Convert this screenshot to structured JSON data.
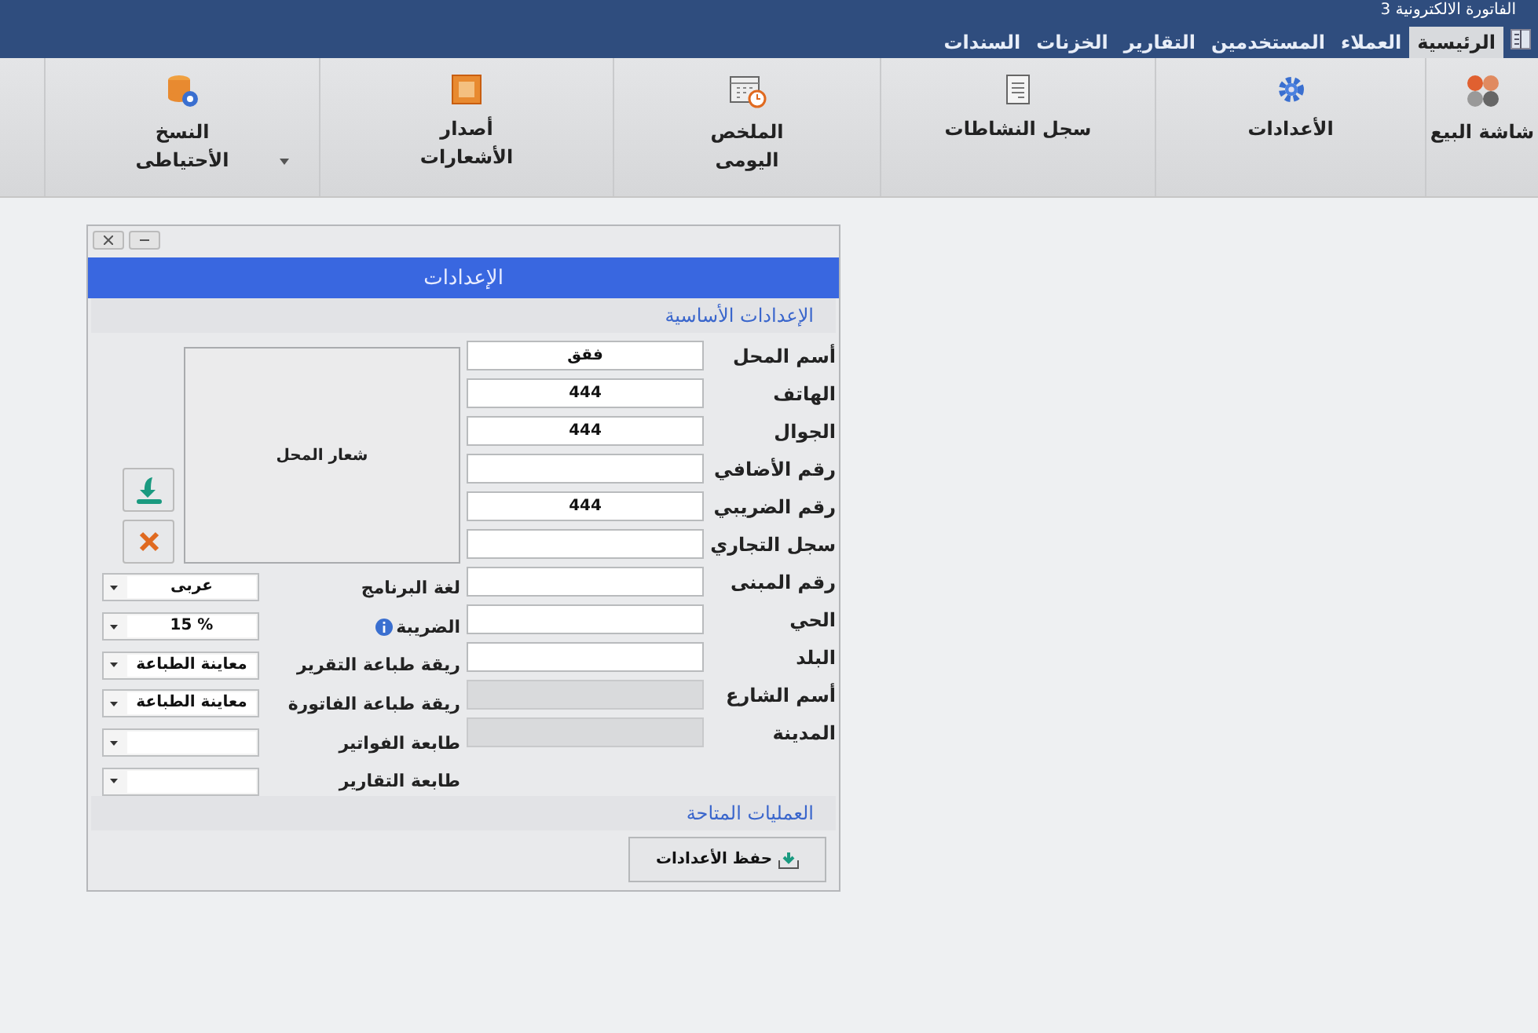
{
  "app_title": "الفاتورة الالكترونية 3",
  "menu_tabs": [
    {
      "label": "الرئيسية",
      "selected": true
    },
    {
      "label": "العملاء",
      "selected": false
    },
    {
      "label": "المستخدمين",
      "selected": false
    },
    {
      "label": "التقارير",
      "selected": false
    },
    {
      "label": "الخزنات",
      "selected": false
    },
    {
      "label": "السندات",
      "selected": false
    }
  ],
  "ribbon": [
    {
      "kind": "dots",
      "lines": [
        "شاشة البيع"
      ],
      "has_menu": false
    },
    {
      "kind": "gear",
      "lines": [
        "الأعدادات"
      ],
      "has_menu": false
    },
    {
      "kind": "document",
      "lines": [
        "سجل النشاطات"
      ],
      "has_menu": false
    },
    {
      "kind": "calendar",
      "lines": [
        "الملخص",
        "اليومى"
      ],
      "has_menu": false
    },
    {
      "kind": "notice",
      "lines": [
        "أصدار",
        "الأشعارات"
      ],
      "has_menu": false
    },
    {
      "kind": "backup",
      "lines": [
        "النسخ",
        "الأحتياطى"
      ],
      "has_menu": true
    }
  ],
  "dialog": {
    "title": "الإعدادات",
    "section_basic": "الإعدادات الأساسية",
    "fields": [
      {
        "label": "أسم المحل",
        "value": "فقق",
        "disabled": false
      },
      {
        "label": "الهاتف",
        "value": "444",
        "disabled": false
      },
      {
        "label": "الجوال",
        "value": "444",
        "disabled": false
      },
      {
        "label": "رقم الأضافي",
        "disabled": false
      },
      {
        "label": "رقم الضريبي",
        "value": "444",
        "disabled": false
      },
      {
        "label": "سجل التجاري",
        "disabled": false
      },
      {
        "label": "رقم المبنى",
        "disabled": false
      },
      {
        "label": "الحي",
        "disabled": false
      },
      {
        "label": "البلد",
        "disabled": false
      },
      {
        "label": "أسم الشارع",
        "disabled": true
      },
      {
        "label": "المدينة",
        "disabled": true
      }
    ],
    "logo_label": "شعار المحل",
    "options": [
      {
        "label": "لغة البرنامج",
        "value": "عربى",
        "info": false
      },
      {
        "label": "الضريبة",
        "value": "15 %",
        "info": true
      },
      {
        "label": "ريقة طباعة التقرير",
        "value": "معاينة الطباعة",
        "info": false
      },
      {
        "label": "ريقة طباعة الفاتورة",
        "value": "معاينة الطباعة",
        "info": false
      },
      {
        "label": "طابعة الفواتير",
        "info": false
      },
      {
        "label": "طابعة التقارير",
        "info": false
      }
    ],
    "section_actions": "العمليات المتاحة",
    "save_button": "حفظ الأعدادات"
  }
}
